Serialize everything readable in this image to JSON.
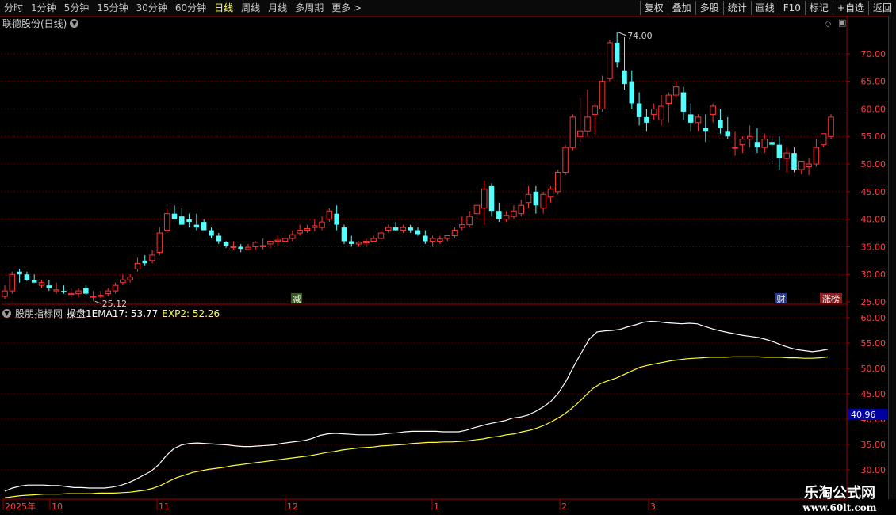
{
  "toolbar": {
    "periods": [
      "分时",
      "1分钟",
      "5分钟",
      "15分钟",
      "30分钟",
      "60分钟",
      "日线",
      "周线",
      "月线",
      "多周期",
      "更多"
    ],
    "active_period": "日线",
    "more_arrow": ">",
    "buttons": [
      "复权",
      "叠加",
      "多股",
      "统计",
      "画线",
      "F10",
      "标记",
      "+自选",
      "返回"
    ]
  },
  "stock": {
    "title": "联德股份(日线)"
  },
  "indicator": {
    "name": "股朋指标网",
    "line1_label": "操盘1EMA17: 53.77",
    "line2_label": "EXP2: 52.26",
    "line1_color": "#ffffff",
    "line2_color": "#ffff33"
  },
  "price_axis": {
    "ticks": [
      "70.00",
      "65.00",
      "60.00",
      "55.00",
      "50.00",
      "45.00",
      "40.00",
      "35.00",
      "30.00",
      "25.00"
    ]
  },
  "indicator_axis": {
    "ticks": [
      "60.00",
      "55.00",
      "50.00",
      "45.00",
      "40.00",
      "35.00",
      "30.00"
    ],
    "highlight": "40.96"
  },
  "date_axis": {
    "labels": [
      "2025年",
      "10",
      "11",
      "12",
      "1",
      "2",
      "3"
    ]
  },
  "annotations": {
    "high": "74.00",
    "low": "25.12",
    "tags": [
      "减",
      "财",
      "涨榜"
    ]
  },
  "watermark": {
    "line1": "乐淘公式网",
    "line2": "www.60lt.com"
  },
  "colors": {
    "up": "#ff3232",
    "down": "#54ffff",
    "grid": "#7a0000",
    "axis": "#a00000"
  },
  "chart_data": {
    "type": "candlestick",
    "open": [
      26.0,
      27.0,
      30.5,
      30.0,
      29.0,
      28.0,
      28.0,
      27.0,
      27.0,
      26.5,
      26.5,
      27.5,
      26.0,
      26.0,
      26.5,
      27.0,
      28.5,
      29.0,
      31.0,
      32.5,
      32.5,
      34.0,
      38.0,
      41.0,
      40.5,
      40.0,
      39.0,
      39.5,
      38.0,
      37.0,
      35.8,
      35.0,
      35.0,
      34.5,
      35.0,
      35.0,
      35.5,
      36.0,
      36.0,
      36.5,
      37.5,
      38.0,
      38.5,
      38.5,
      40.0,
      41.0,
      38.5,
      36.0,
      35.5,
      35.7,
      36.0,
      36.5,
      38.0,
      38.5,
      38.0,
      38.5,
      38.0,
      37.0,
      36.0,
      36.0,
      36.5,
      37.0,
      38.5,
      39.0,
      41.0,
      42.0,
      46.0,
      41.5,
      40.0,
      40.5,
      41.0,
      43.0,
      45.0,
      42.0,
      44.0,
      45.0,
      48.5,
      53.0,
      55.0,
      56.0,
      59.0,
      60.0,
      65.5,
      72.0,
      67.0,
      65.0,
      61.0,
      58.5,
      59.0,
      58.0,
      61.0,
      62.5,
      63.0,
      59.0,
      57.5,
      56.5,
      59.0,
      58.0,
      56.0,
      53.0,
      53.5,
      54.5,
      54.0,
      53.0,
      54.0,
      53.5,
      51.0,
      52.0,
      49.0,
      49.5,
      50.0,
      53.5,
      55.0
    ],
    "high": [
      28.0,
      30.5,
      31.0,
      30.5,
      30.0,
      29.0,
      29.0,
      28.5,
      28.0,
      27.5,
      27.5,
      28.0,
      27.0,
      27.0,
      27.5,
      28.5,
      30.0,
      30.0,
      33.0,
      33.5,
      34.5,
      38.5,
      42.0,
      42.5,
      42.0,
      41.0,
      41.0,
      40.0,
      38.5,
      37.5,
      36.0,
      36.0,
      35.5,
      35.5,
      36.0,
      36.5,
      36.0,
      37.0,
      37.5,
      38.0,
      39.0,
      39.0,
      40.0,
      40.5,
      42.0,
      42.5,
      39.0,
      37.0,
      36.0,
      36.5,
      37.0,
      38.0,
      39.0,
      39.5,
      39.0,
      39.0,
      38.5,
      38.0,
      37.0,
      37.0,
      37.0,
      38.5,
      40.5,
      41.5,
      43.0,
      47.0,
      46.5,
      43.0,
      41.5,
      42.5,
      43.5,
      46.0,
      46.0,
      45.0,
      46.0,
      49.0,
      53.5,
      59.0,
      62.0,
      63.5,
      61.0,
      66.0,
      72.5,
      74.0,
      73.0,
      67.0,
      63.0,
      60.0,
      61.0,
      62.5,
      63.0,
      65.0,
      64.0,
      61.0,
      59.0,
      59.0,
      61.0,
      60.0,
      58.5,
      56.0,
      55.0,
      57.0,
      56.5,
      55.5,
      55.0,
      55.0,
      53.0,
      53.0,
      50.0,
      51.0,
      54.5,
      55.5,
      59.0
    ],
    "low": [
      25.5,
      26.5,
      28.5,
      28.8,
      28.5,
      27.5,
      27.0,
      26.5,
      26.5,
      25.8,
      25.9,
      26.3,
      25.12,
      25.7,
      26.0,
      26.5,
      28.0,
      28.5,
      30.5,
      31.5,
      32.0,
      33.5,
      37.5,
      40.0,
      39.5,
      38.5,
      38.0,
      38.0,
      36.5,
      35.5,
      34.8,
      34.5,
      34.0,
      34.3,
      34.5,
      34.5,
      34.8,
      35.2,
      35.5,
      36.0,
      37.0,
      37.5,
      37.8,
      38.0,
      39.5,
      38.0,
      35.5,
      35.0,
      35.0,
      35.0,
      35.8,
      36.3,
      37.5,
      37.8,
      37.5,
      37.5,
      37.0,
      35.5,
      35.0,
      35.5,
      36.0,
      36.5,
      38.0,
      38.5,
      40.0,
      39.0,
      40.5,
      39.5,
      39.5,
      40.0,
      40.5,
      42.0,
      41.0,
      41.0,
      43.0,
      44.5,
      48.0,
      52.5,
      54.0,
      55.0,
      55.5,
      59.5,
      65.0,
      67.5,
      63.5,
      60.0,
      57.0,
      56.0,
      58.0,
      57.0,
      57.5,
      62.0,
      58.0,
      56.0,
      56.0,
      54.0,
      57.5,
      55.5,
      54.5,
      51.5,
      52.0,
      53.0,
      52.0,
      52.0,
      50.0,
      49.0,
      48.5,
      48.5,
      48.2,
      48.0,
      49.5,
      53.0,
      54.5
    ],
    "close": [
      27.0,
      30.0,
      30.0,
      29.0,
      28.5,
      28.5,
      27.5,
      27.2,
      26.8,
      26.5,
      27.0,
      26.5,
      26.0,
      26.2,
      27.0,
      28.0,
      29.0,
      29.5,
      32.0,
      32.0,
      33.5,
      37.5,
      41.0,
      40.0,
      39.0,
      39.5,
      38.5,
      38.0,
      37.0,
      36.0,
      35.2,
      35.0,
      34.6,
      34.9,
      35.8,
      35.2,
      36.0,
      36.2,
      36.5,
      37.2,
      38.0,
      38.3,
      38.8,
      39.5,
      41.5,
      39.0,
      36.0,
      35.5,
      35.8,
      36.0,
      36.5,
      37.5,
      38.5,
      38.0,
      38.5,
      38.0,
      37.3,
      36.0,
      36.5,
      36.4,
      37.0,
      38.0,
      39.0,
      40.5,
      42.5,
      45.5,
      41.5,
      40.0,
      40.7,
      41.5,
      42.5,
      44.5,
      42.5,
      44.5,
      45.5,
      48.5,
      53.0,
      58.5,
      56.0,
      58.5,
      60.5,
      65.0,
      72.0,
      68.5,
      64.5,
      61.0,
      58.5,
      57.5,
      60.0,
      60.5,
      62.5,
      64.0,
      59.5,
      57.5,
      58.5,
      56.0,
      60.5,
      56.5,
      55.0,
      53.0,
      54.5,
      55.0,
      53.0,
      54.5,
      53.5,
      51.0,
      52.0,
      49.0,
      50.5,
      50.0,
      53.0,
      55.5,
      58.5
    ],
    "ema17": [
      25.8,
      26.4,
      26.8,
      27.0,
      27.0,
      27.0,
      26.9,
      26.9,
      26.7,
      26.5,
      26.5,
      26.4,
      26.4,
      26.4,
      26.6,
      26.9,
      27.4,
      28.1,
      28.9,
      29.7,
      31.0,
      32.8,
      34.2,
      34.9,
      35.2,
      35.3,
      35.2,
      35.1,
      35.0,
      34.9,
      34.7,
      34.6,
      34.6,
      34.7,
      34.8,
      34.9,
      35.2,
      35.4,
      35.6,
      35.8,
      36.2,
      36.8,
      37.1,
      37.2,
      37.1,
      37.0,
      36.9,
      36.9,
      36.9,
      37.0,
      37.2,
      37.3,
      37.5,
      37.6,
      37.6,
      37.6,
      37.6,
      37.5,
      37.5,
      37.5,
      37.8,
      38.3,
      38.7,
      39.1,
      39.4,
      39.7,
      40.2,
      40.4,
      40.8,
      41.5,
      42.4,
      43.5,
      45.2,
      47.6,
      50.5,
      53.2,
      55.8,
      57.2,
      57.4,
      57.5,
      57.7,
      58.2,
      58.6,
      59.1,
      59.3,
      59.2,
      59.0,
      58.9,
      58.8,
      58.9,
      58.8,
      58.3,
      57.8,
      57.4,
      57.1,
      56.8,
      56.5,
      56.3,
      56.1,
      55.7,
      55.2,
      54.6,
      54.1,
      53.7,
      53.5,
      53.3,
      53.5,
      53.77
    ],
    "exp2": [
      24.5,
      24.7,
      24.9,
      25.0,
      25.1,
      25.2,
      25.2,
      25.2,
      25.3,
      25.3,
      25.3,
      25.3,
      25.4,
      25.4,
      25.4,
      25.5,
      25.6,
      25.8,
      26.0,
      26.4,
      27.0,
      27.8,
      28.5,
      29.0,
      29.5,
      29.8,
      30.1,
      30.3,
      30.5,
      30.8,
      31.0,
      31.2,
      31.4,
      31.6,
      31.8,
      32.0,
      32.2,
      32.4,
      32.6,
      32.8,
      33.1,
      33.4,
      33.6,
      33.9,
      34.1,
      34.3,
      34.4,
      34.5,
      34.7,
      34.8,
      34.9,
      35.0,
      35.2,
      35.3,
      35.4,
      35.4,
      35.5,
      35.5,
      35.6,
      35.7,
      35.9,
      36.1,
      36.4,
      36.6,
      36.9,
      37.1,
      37.5,
      37.8,
      38.3,
      38.9,
      39.7,
      40.6,
      41.7,
      43.0,
      44.5,
      46.0,
      47.0,
      47.6,
      48.1,
      48.8,
      49.5,
      50.2,
      50.6,
      50.9,
      51.2,
      51.5,
      51.7,
      51.9,
      52.0,
      52.1,
      52.2,
      52.2,
      52.2,
      52.3,
      52.3,
      52.3,
      52.3,
      52.2,
      52.2,
      52.2,
      52.1,
      52.1,
      52.0,
      52.0,
      52.1,
      52.26
    ]
  }
}
